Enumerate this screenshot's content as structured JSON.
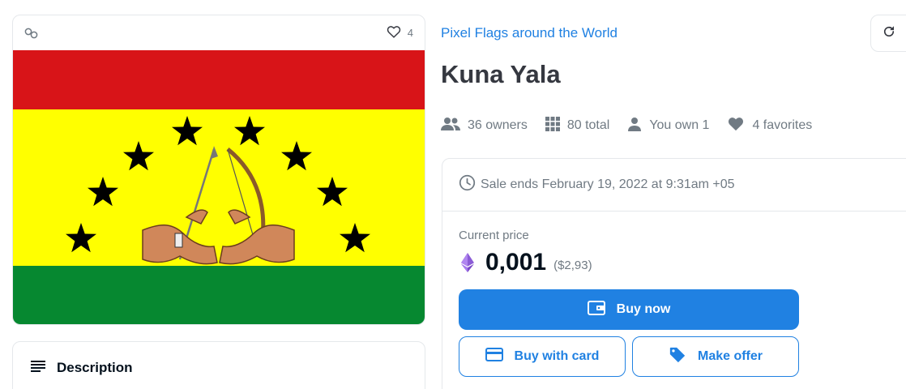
{
  "item": {
    "favorites_count": "4",
    "collection": "Pixel Flags around the World",
    "name": "Kuna Yala"
  },
  "stats": {
    "owners": "36 owners",
    "total": "80 total",
    "you_own": "You own 1",
    "favorites": "4 favorites"
  },
  "sale": {
    "ends": "Sale ends February 19, 2022 at 9:31am +05",
    "current_price_label": "Current price",
    "price": "0,001",
    "usd": "($2,93)"
  },
  "buttons": {
    "buy_now": "Buy now",
    "buy_with_card": "Buy with card",
    "make_offer": "Make offer"
  },
  "description": {
    "label": "Description"
  },
  "colors": {
    "accent": "#2081e2",
    "flag_red": "#d81418",
    "flag_yellow": "#ffff00",
    "flag_green": "#068830"
  }
}
